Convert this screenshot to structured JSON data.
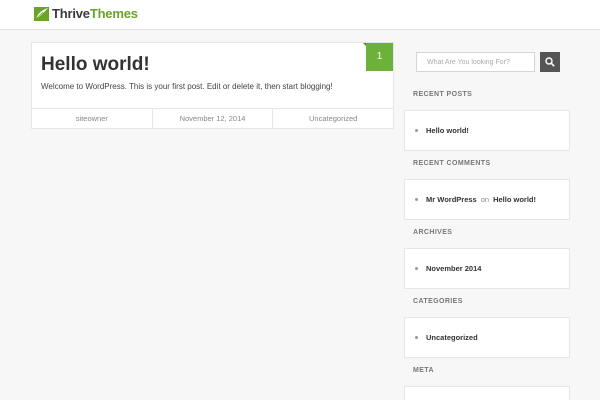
{
  "header": {
    "logo_word1": "Thrive",
    "logo_word2": "Themes",
    "logo_icon": "leaf-logo-icon",
    "accent_color": "#6aa329"
  },
  "post": {
    "title": "Hello world!",
    "excerpt": "Welcome to WordPress. This is your first post. Edit or delete it, then start blogging!",
    "comment_count": "1",
    "author": "siteowner",
    "date": "November 12, 2014",
    "category": "Uncategorized",
    "badge_color": "#6cb13a"
  },
  "search": {
    "placeholder": "What Are You looking For?",
    "button_icon": "search-icon"
  },
  "sidebar": {
    "recent_posts": {
      "title": "RECENT POSTS",
      "items": [
        "Hello world!"
      ]
    },
    "recent_comments": {
      "title": "RECENT COMMENTS",
      "author": "Mr WordPress",
      "on": "on",
      "post": "Hello world!"
    },
    "archives": {
      "title": "ARCHIVES",
      "items": [
        "November 2014"
      ]
    },
    "categories": {
      "title": "CATEGORIES",
      "items": [
        "Uncategorized"
      ]
    },
    "meta": {
      "title": "META"
    }
  }
}
